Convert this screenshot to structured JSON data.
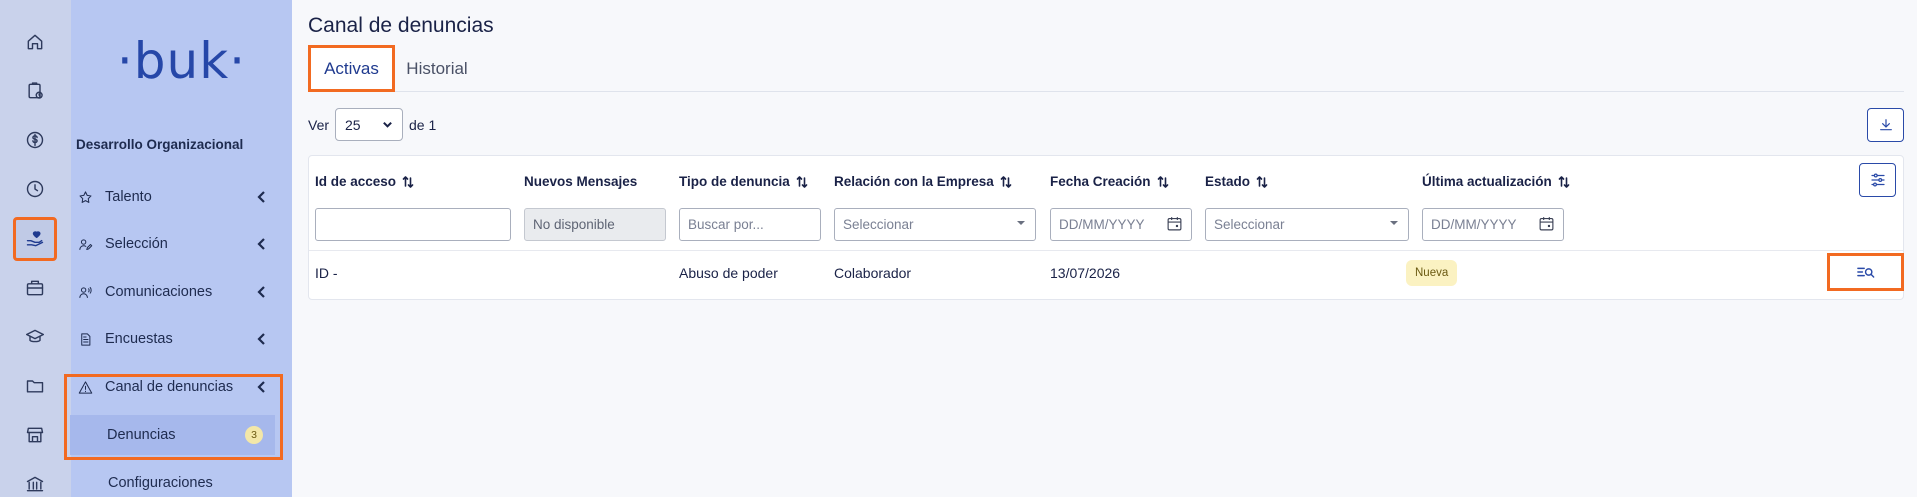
{
  "colors": {
    "rail_bg": "#c9d2eb",
    "sidebar_bg": "#b7c7f2",
    "accent": "#2a4aa8",
    "highlight": "#f26a21",
    "badge_bg": "#fbf2c2"
  },
  "rail": {
    "icons": [
      "home-icon",
      "clipboard-clock-icon",
      "dollar-circle-icon",
      "clock-icon",
      "hand-heart-icon",
      "briefcase-icon",
      "graduation-cap-icon",
      "folder-icon",
      "store-icon",
      "bank-icon"
    ],
    "active_icon": "hand-heart-icon"
  },
  "sidebar": {
    "logo": "·buk·",
    "section_title": "Desarrollo Organizacional",
    "items": [
      {
        "label": "Talento",
        "icon": "star-icon"
      },
      {
        "label": "Selección",
        "icon": "user-pen-icon"
      },
      {
        "label": "Comunicaciones",
        "icon": "user-voice-icon"
      },
      {
        "label": "Encuestas",
        "icon": "document-icon"
      },
      {
        "label": "Canal de denuncias",
        "icon": "warning-triangle-icon"
      }
    ],
    "submenu": [
      {
        "label": "Denuncias",
        "count": "3",
        "active": true
      },
      {
        "label": "Configuraciones"
      }
    ]
  },
  "main": {
    "title": "Canal de denuncias",
    "tabs": [
      {
        "label": "Activas",
        "active": true
      },
      {
        "label": "Historial"
      }
    ],
    "pager": {
      "prefix": "Ver",
      "page_size": "25",
      "suffix": "de 1"
    },
    "table": {
      "columns": [
        {
          "label": "Id de acceso",
          "sortable": true
        },
        {
          "label": "Nuevos Mensajes",
          "sortable": false
        },
        {
          "label": "Tipo de denuncia",
          "sortable": true
        },
        {
          "label": "Relación con la Empresa",
          "sortable": true
        },
        {
          "label": "Fecha Creación",
          "sortable": true
        },
        {
          "label": "Estado",
          "sortable": true
        },
        {
          "label": "Última actualización",
          "sortable": true
        }
      ],
      "filters": {
        "id_value": "",
        "messages_placeholder": "No disponible",
        "type_placeholder": "Buscar por...",
        "relation_placeholder": "Seleccionar",
        "created_placeholder": "DD/MM/YYYY",
        "status_placeholder": "Seleccionar",
        "updated_placeholder": "DD/MM/YYYY"
      },
      "rows": [
        {
          "id": "ID -",
          "messages": "",
          "type": "Abuso de poder",
          "relation": "Colaborador",
          "created": "13/07/2026",
          "status": "Nueva",
          "updated": ""
        }
      ]
    }
  }
}
